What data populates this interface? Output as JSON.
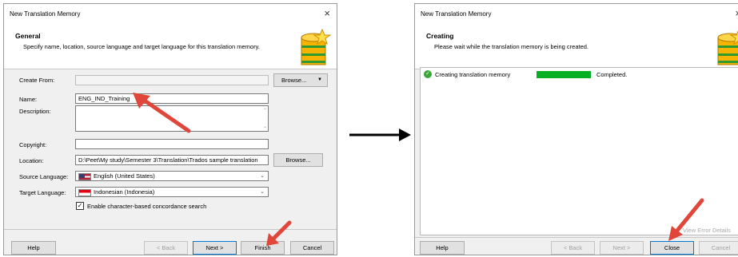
{
  "dialog1": {
    "title": "New Translation Memory",
    "close_glyph": "×",
    "header_title": "General",
    "header_subtitle": "Specify name, location, source language and target language for this translation memory.",
    "create_from_label": "Create From:",
    "create_from_value": "",
    "browse_split_label": "Browse...",
    "name_label": "Name:",
    "name_value": "ENG_IND_Training",
    "description_label": "Description:",
    "description_value": "",
    "copyright_label": "Copyright:",
    "copyright_value": "",
    "location_label": "Location:",
    "location_value": "D:\\Peet\\My study\\Semester 3\\Translation\\Trados sample translation",
    "browse_label": "Browse...",
    "source_language_label": "Source Language:",
    "source_language_value": "English (United States)",
    "target_language_label": "Target Language:",
    "target_language_value": "Indonesian (Indonesia)",
    "concordance_label": "Enable character-based concordance search",
    "concordance_checked": true,
    "help_label": "Help",
    "back_label": "< Back",
    "next_label": "Next >",
    "finish_label": "Finish",
    "cancel_label": "Cancel"
  },
  "dialog2": {
    "title": "New Translation Memory",
    "close_glyph": "×",
    "header_title": "Creating",
    "header_subtitle": "Please wait while the translation memory is being created.",
    "task_label": "Creating translation memory",
    "task_progress": 1.0,
    "task_status": "Completed.",
    "view_errors_label": "View Error Details",
    "help_label": "Help",
    "back_label": "< Back",
    "next_label": "Next >",
    "close_label": "Close",
    "cancel_label": "Cancel"
  },
  "colors": {
    "annotation_arrow": "#e0463a",
    "progress_fill": "#06b025",
    "flow_arrow": "#000000"
  }
}
